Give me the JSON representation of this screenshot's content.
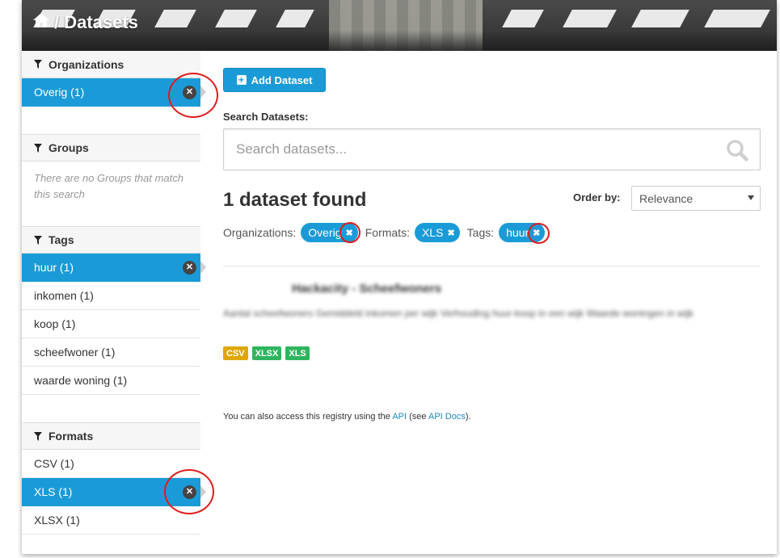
{
  "header": {
    "title": "/ Datasets",
    "home_icon": "home-icon"
  },
  "sidebar": {
    "organizations": {
      "heading": "Organizations",
      "items": [
        {
          "label": "Overig (1)",
          "active": true
        }
      ]
    },
    "groups": {
      "heading": "Groups",
      "empty_text": "There are no Groups that match this search"
    },
    "tags": {
      "heading": "Tags",
      "items": [
        {
          "label": "huur (1)",
          "active": true
        },
        {
          "label": "inkomen (1)",
          "active": false
        },
        {
          "label": "koop (1)",
          "active": false
        },
        {
          "label": "scheefwoner (1)",
          "active": false
        },
        {
          "label": "waarde woning (1)",
          "active": false
        }
      ]
    },
    "formats": {
      "heading": "Formats",
      "items": [
        {
          "label": "CSV (1)",
          "active": false
        },
        {
          "label": "XLS (1)",
          "active": true
        },
        {
          "label": "XLSX (1)",
          "active": false
        }
      ]
    }
  },
  "main": {
    "add_button": "Add Dataset",
    "search_label": "Search Datasets:",
    "search_placeholder": "Search datasets...",
    "result_count": "1 dataset found",
    "order_label": "Order by:",
    "order_value": "Relevance",
    "filters": [
      {
        "label": "Organizations:",
        "pill": "Overig"
      },
      {
        "label": "Formats:",
        "pill": "XLS"
      },
      {
        "label": "Tags:",
        "pill": "huur"
      }
    ],
    "dataset": {
      "title": "Hackacity - Scheefwoners",
      "notes": "Aantal scheefwoners Gemiddeld inkomen per wijk Verhouding huur-koop in een wijk Waarde woningen in wijk",
      "formats": [
        {
          "label": "CSV",
          "color": "#dfa700"
        },
        {
          "label": "XLSX",
          "color": "#2db55d"
        },
        {
          "label": "XLS",
          "color": "#2db55d"
        }
      ]
    },
    "api_note": {
      "prefix": "You can also access this registry using the",
      "api_link": "API",
      "middle": "(see",
      "docs_link": "API Docs",
      "suffix": ")."
    }
  },
  "colors": {
    "accent": "#1a9bd7",
    "annotation": "#e01b1b"
  }
}
